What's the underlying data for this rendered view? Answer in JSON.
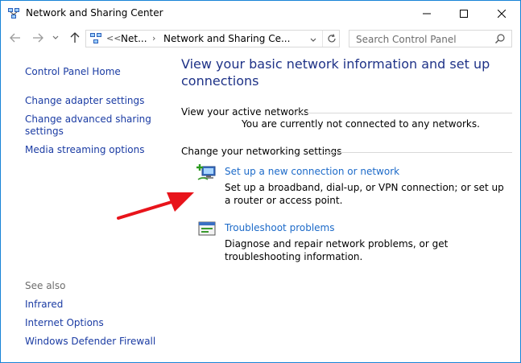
{
  "window": {
    "title": "Network and Sharing Center"
  },
  "nav": {
    "address_segments": [
      "Net...",
      "Network and Sharing Ce..."
    ],
    "address_overflow": "<<",
    "search_placeholder": "Search Control Panel"
  },
  "sidebar": {
    "home": "Control Panel Home",
    "links": [
      "Change adapter settings",
      "Change advanced sharing settings",
      "Media streaming options"
    ],
    "see_also_label": "See also",
    "see_also": [
      "Infrared",
      "Internet Options",
      "Windows Defender Firewall"
    ]
  },
  "main": {
    "heading": "View your basic network information and set up connections",
    "active_networks_label": "View your active networks",
    "no_networks_text": "You are currently not connected to any networks.",
    "change_settings_label": "Change your networking settings",
    "tasks": [
      {
        "link": "Set up a new connection or network",
        "description": "Set up a broadband, dial-up, or VPN connection; or set up a router or access point.",
        "icon": "new-connection-icon"
      },
      {
        "link": "Troubleshoot problems",
        "description": "Diagnose and repair network problems, or get troubleshooting information.",
        "icon": "troubleshoot-icon"
      }
    ]
  },
  "colors": {
    "accent_border": "#1883d7",
    "heading": "#1e3287",
    "link": "#1a3ba3",
    "task_link": "#1c6ac9",
    "annotation_arrow": "#e8141b"
  }
}
